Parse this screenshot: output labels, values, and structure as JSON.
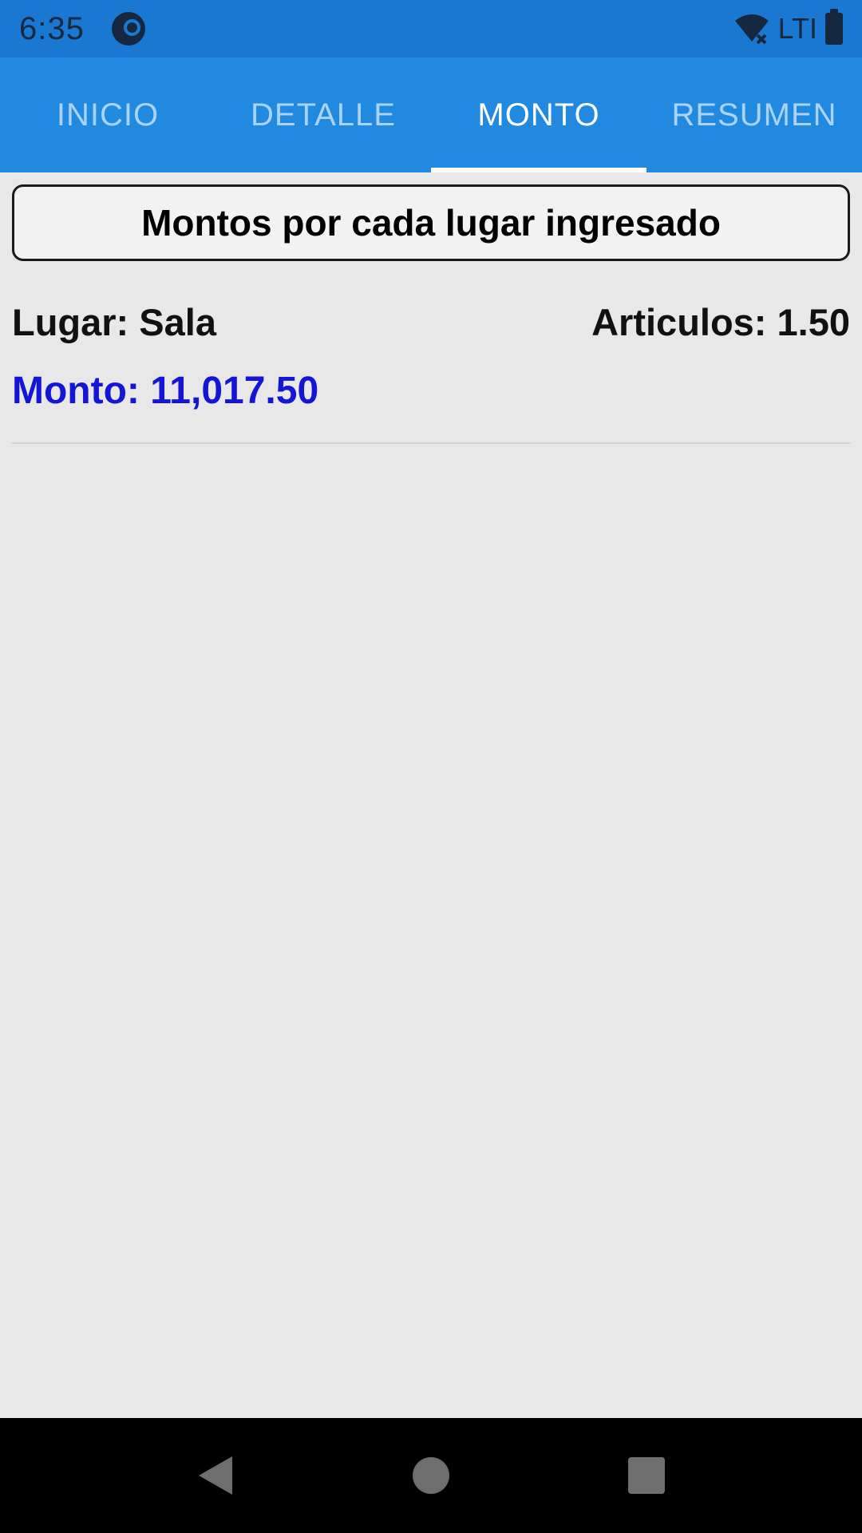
{
  "status_bar": {
    "time": "6:35",
    "network_label": "LTI",
    "icons": [
      "app-notification-icon",
      "wifi-off-icon",
      "battery-icon"
    ]
  },
  "tabs": [
    {
      "label": "INICIO",
      "active": false
    },
    {
      "label": "DETALLE",
      "active": false
    },
    {
      "label": "MONTO",
      "active": true
    },
    {
      "label": "RESUMEN",
      "active": false
    }
  ],
  "main": {
    "header_title": "Montos por cada lugar ingresado",
    "entries": [
      {
        "lugar": "Lugar: Sala",
        "articulos": "Articulos: 1.50",
        "monto": "Monto: 11,017.50"
      }
    ]
  },
  "colors": {
    "status_bar": "#1a78d2",
    "tab_bar": "#2189e0",
    "monto_text": "#1515d4",
    "background": "#e8e8e9"
  },
  "nav_bar": {
    "icons": [
      "back-icon",
      "home-icon",
      "recents-icon"
    ]
  }
}
